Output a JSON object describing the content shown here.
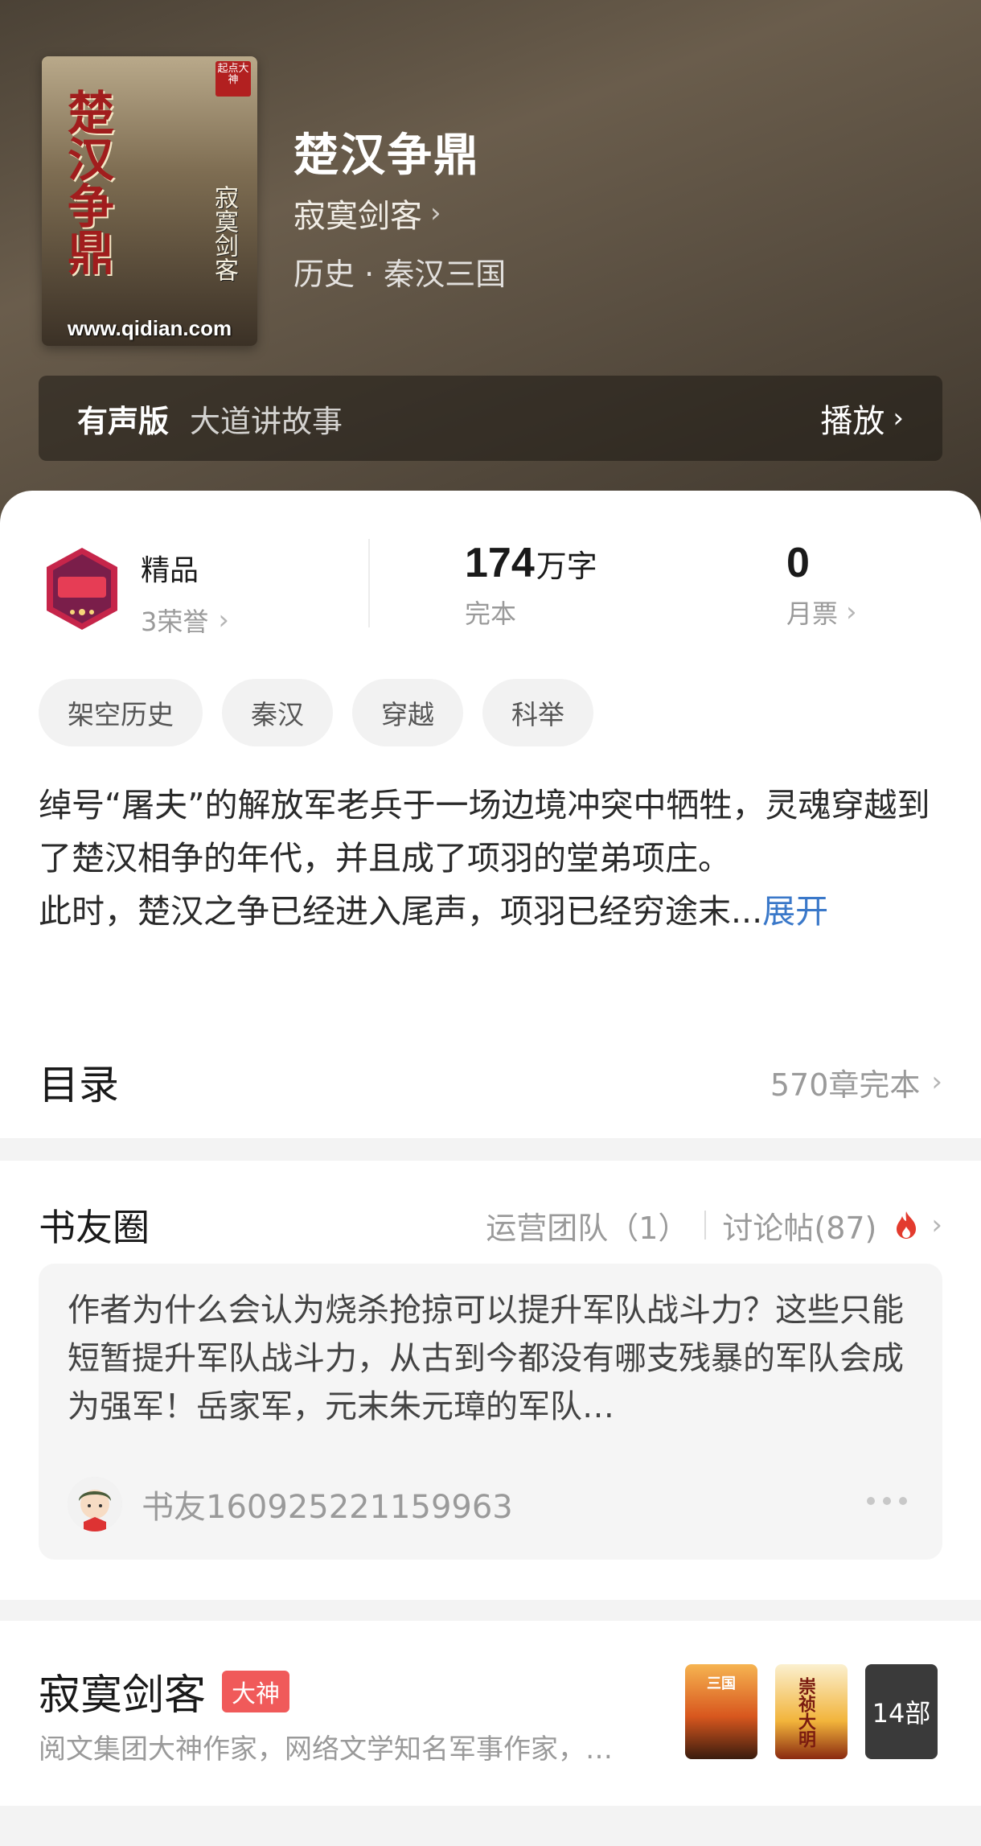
{
  "book": {
    "title": "楚汉争鼎",
    "author": "寂寞剑客",
    "genre": "历史 · 秦汉三国",
    "cover": {
      "title": "楚汉争鼎",
      "author": "寂寞剑客",
      "seal": "起点大神",
      "url": "www.qidian.com"
    }
  },
  "audio": {
    "label": "有声版",
    "narrator": "大道讲故事",
    "play_label": "播放"
  },
  "stats": {
    "quality": "精品",
    "honors": "3荣誉",
    "words_num": "174",
    "words_unit": "万字",
    "status": "完本",
    "votes": "0",
    "votes_label": "月票"
  },
  "tags": [
    "架空历史",
    "秦汉",
    "穿越",
    "科举"
  ],
  "synopsis": {
    "text": "绰号“屠夫”的解放军老兵于一场边境冲突中牺牲，灵魂穿越到了楚汉相争的年代，并且成了项羽的堂弟项庄。\n此时，楚汉之争已经进入尾声，项羽已经穷途末...",
    "expand": "展开"
  },
  "toc": {
    "title": "目录",
    "count": "570章完本"
  },
  "community": {
    "title": "书友圈",
    "team": "运营团队（1）",
    "threads": "讨论帖(87)",
    "post": {
      "text": "作者为什么会认为烧杀抢掠可以提升军队战斗力？这些只能短暂提升军队战斗力，从古到今都没有哪支残暴的军队会成为强军！岳家军，元末朱元璋的军队…",
      "user": "书友160925221159963"
    }
  },
  "author_card": {
    "name": "寂寞剑客",
    "badge": "大神",
    "desc": "阅文集团大神作家，网络文学知名军事作家，…",
    "works_count": "14部",
    "work1_title": "三国",
    "work2_title": "崇祯大明"
  },
  "icons": {
    "badge": "quality-badge-icon",
    "flame": "flame-icon"
  },
  "colors": {
    "accent_link": "#3a78c9",
    "badge_red": "#f05a5a"
  }
}
